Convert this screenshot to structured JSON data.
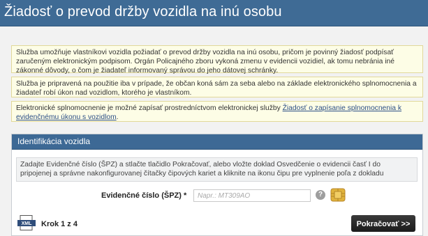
{
  "header": {
    "title": "Žiadosť o prevod držby vozidla na inú osobu"
  },
  "notices": {
    "n1": "Služba umožňuje vlastníkovi vozidla požiadať o prevod držby vozidla na inú osobu, pričom je povinný žiadosť podpísať zaručeným elektronickým podpisom. Orgán Policajného zboru vykoná zmenu v evidencii vozidiel, ak tomu nebránia iné zákonné dôvody, o čom je žiadateľ informovaný správou do jeho dátovej schránky.",
    "n2": "Služba je pripravená na použitie iba v prípade, že občan koná sám za seba alebo na základe elektronického splnomocnenia a žiadateľ robí úkon nad vozidlom, ktorého je vlastníkom.",
    "n3_text": "Elektronické splnomocnenie je možné zapísať prostredníctvom elektronickej služby ",
    "n3_link": "Žiadosť o zapísanie splnomocnenia k evidenčnému úkonu s vozidlom",
    "n3_end": "."
  },
  "section": {
    "title": "Identifikácia vozidla",
    "info": "Zadajte Evidenčné číslo (ŠPZ) a stlačte tlačidlo Pokračovať, alebo vložte doklad Osvedčenie o evidencii časť I do pripojenej a správne nakonfigurovanej čítačky čipových kariet a kliknite na ikonu čipu pre vyplnenie poľa z dokladu",
    "field_label": "Evidenčné číslo (ŠPZ) *",
    "field_placeholder": "Napr.: MT309AO",
    "field_value": "",
    "help_glyph": "?",
    "step": "Krok 1 z 4",
    "next_button": "Pokračovať >>",
    "xml_label": "XML"
  },
  "icons": {
    "help": "question-icon",
    "chip": "chip-card-icon",
    "xml": "xml-file-icon"
  }
}
